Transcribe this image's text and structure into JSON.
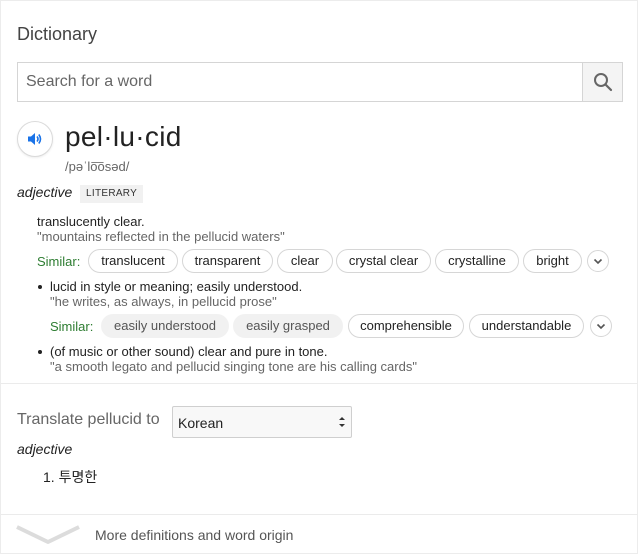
{
  "panel": {
    "title": "Dictionary"
  },
  "search": {
    "placeholder": "Search for a word",
    "value": ""
  },
  "entry": {
    "word": "pel·lu·cid",
    "pronunciation": "/pəˈlo͞osəd/",
    "part_of_speech": "adjective",
    "register_tag": "LITERARY",
    "senses": [
      {
        "definition": "translucently clear.",
        "example": "\"mountains reflected in the pellucid waters\"",
        "similar_label": "Similar:",
        "similar": [
          "translucent",
          "transparent",
          "clear",
          "crystal clear",
          "crystalline",
          "bright"
        ]
      },
      {
        "definition": "lucid in style or meaning; easily understood.",
        "example": "\"he writes, as always, in pellucid prose\"",
        "similar_label": "Similar:",
        "similar": [
          "easily understood",
          "easily grasped",
          "comprehensible",
          "understandable"
        ]
      },
      {
        "definition": "(of music or other sound) clear and pure in tone.",
        "example": "\"a smooth legato and pellucid singing tone are his calling cards\""
      }
    ]
  },
  "translate": {
    "label": "Translate pellucid to",
    "language": "Korean",
    "part_of_speech": "adjective",
    "items": [
      "1. 투명한"
    ]
  },
  "footer": {
    "label": "More definitions and word origin"
  },
  "colors": {
    "similar_label": "#2e7d32",
    "speaker_icon": "#1a73e8"
  }
}
